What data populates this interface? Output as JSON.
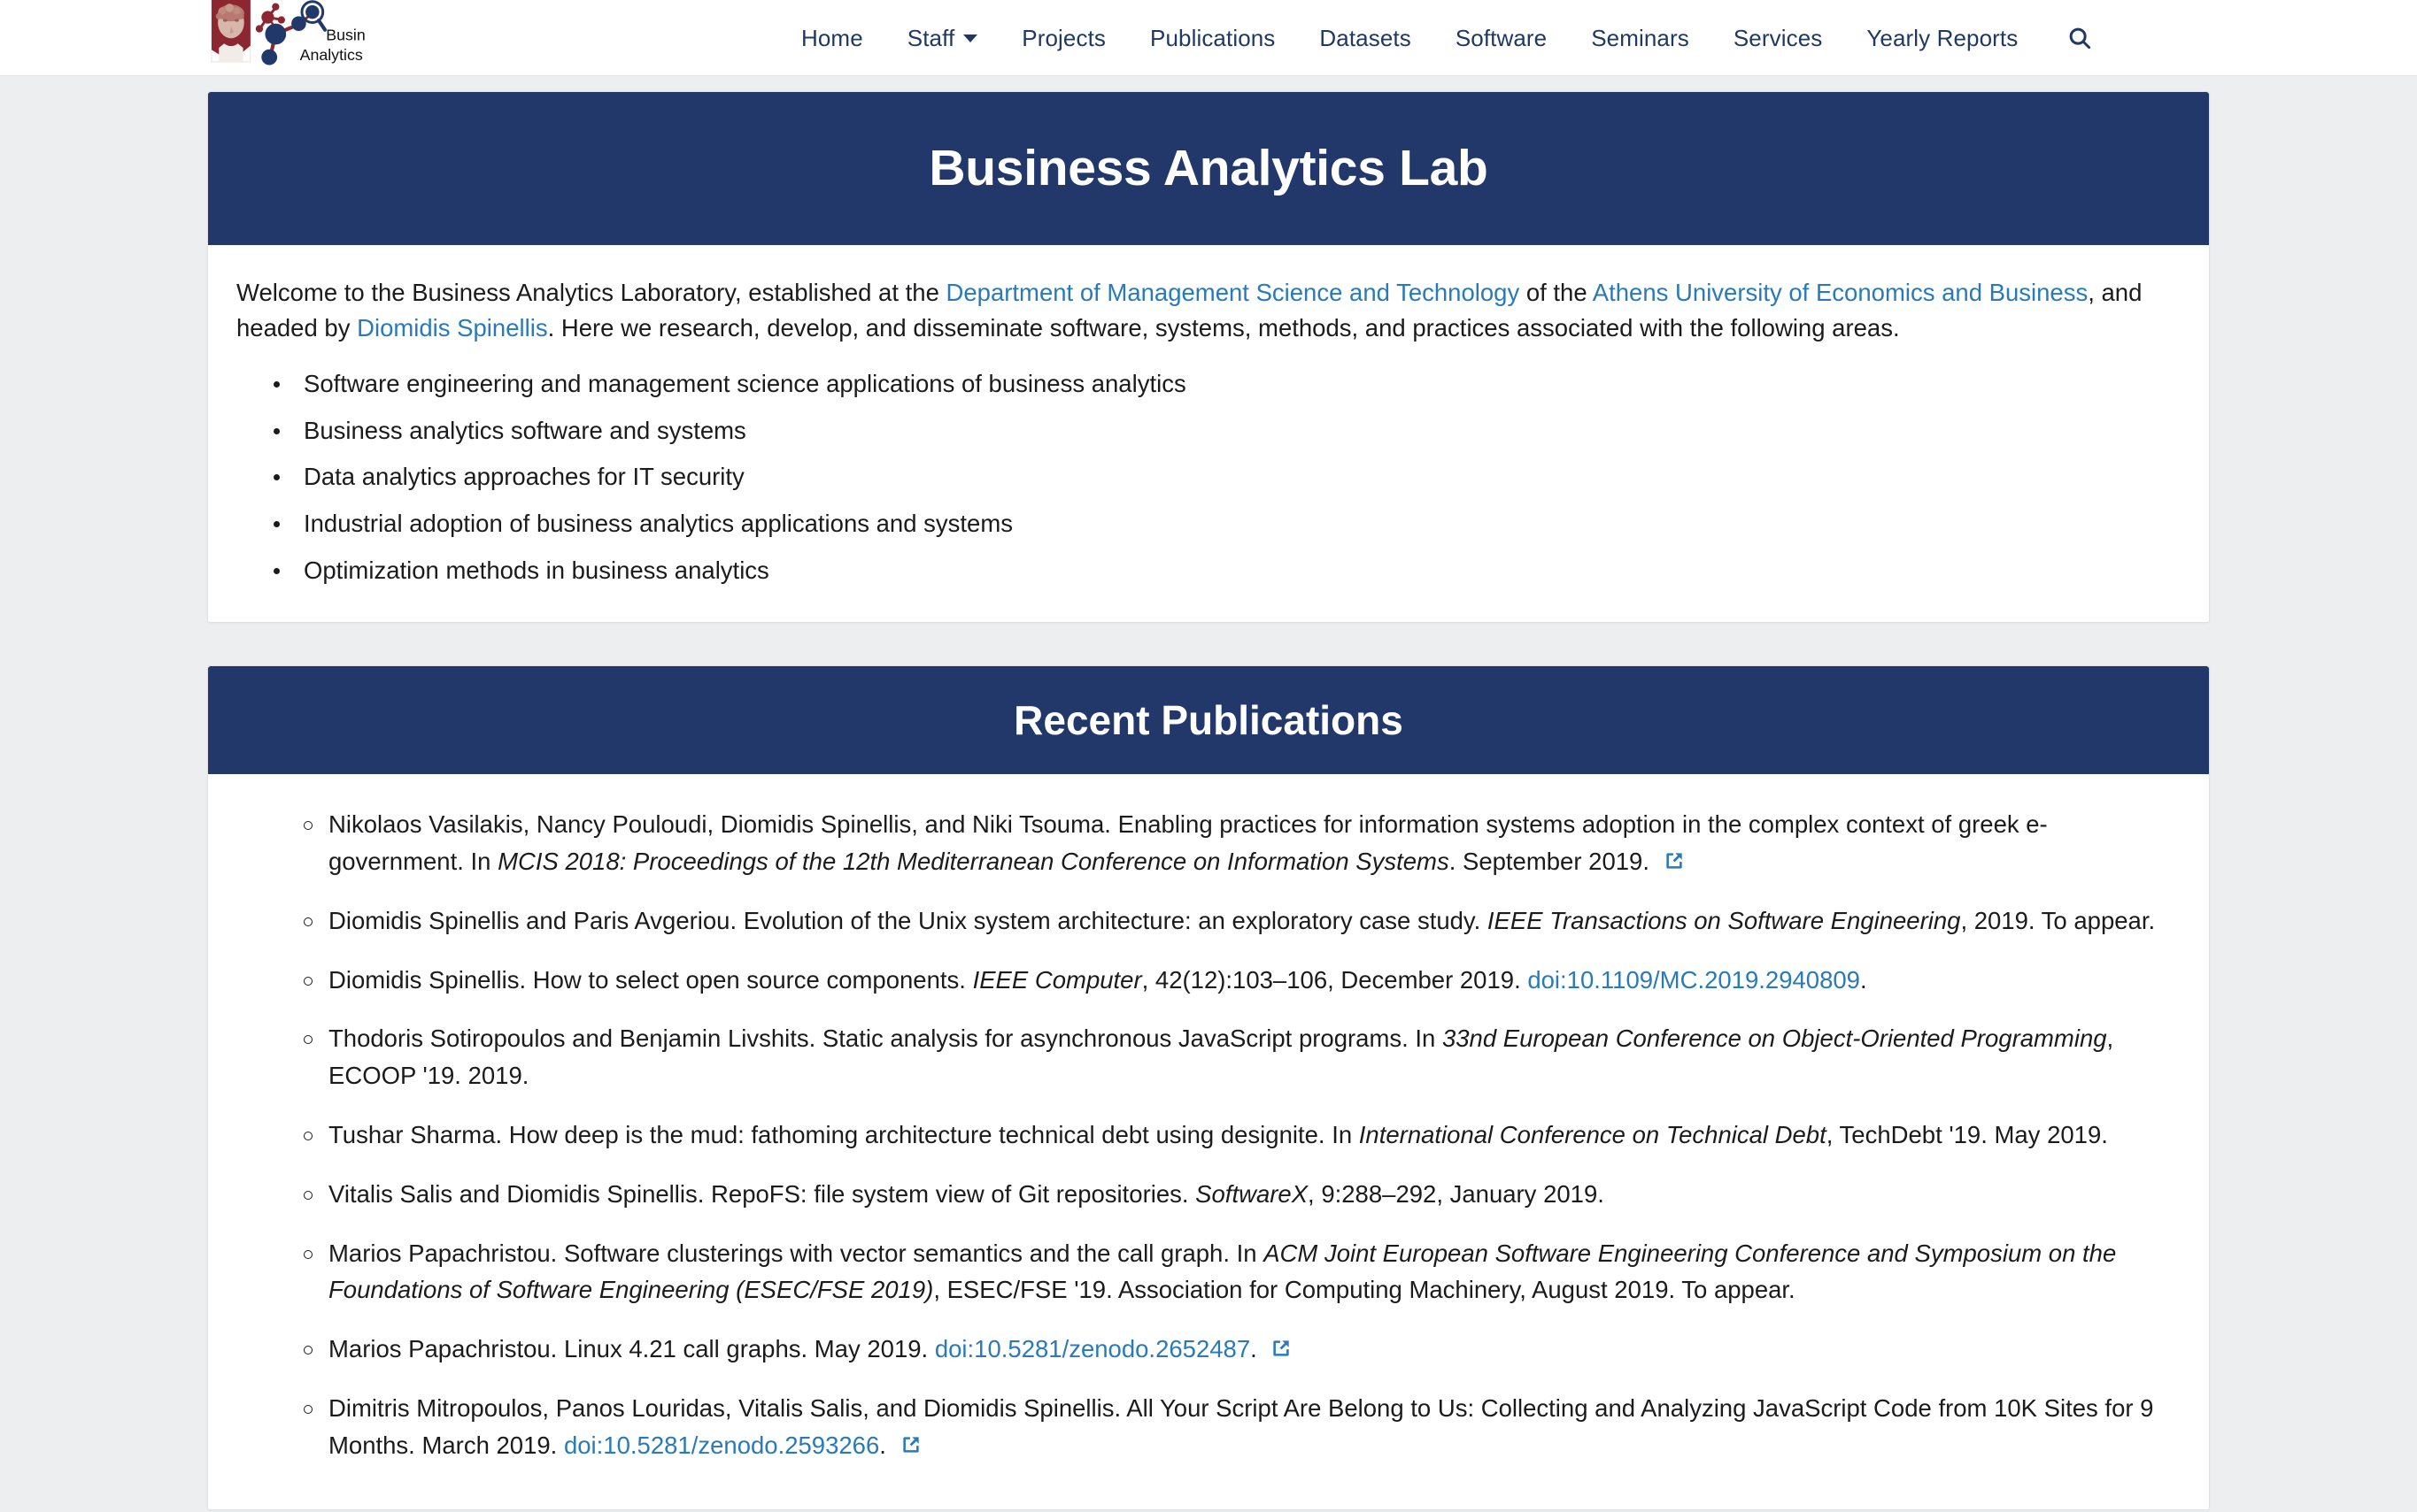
{
  "brand": {
    "name": "Business Analytics Lab",
    "logo_alt": "Business Analytics Lab logo",
    "line1": "Business",
    "line2": "Analytics Lab"
  },
  "nav": {
    "items": [
      {
        "label": "Home",
        "has_caret": false
      },
      {
        "label": "Staff",
        "has_caret": true
      },
      {
        "label": "Projects",
        "has_caret": false
      },
      {
        "label": "Publications",
        "has_caret": false
      },
      {
        "label": "Datasets",
        "has_caret": false
      },
      {
        "label": "Software",
        "has_caret": false
      },
      {
        "label": "Seminars",
        "has_caret": false
      },
      {
        "label": "Services",
        "has_caret": false
      },
      {
        "label": "Yearly Reports",
        "has_caret": false
      }
    ],
    "search_icon": "search-icon"
  },
  "hero": {
    "title": "Business Analytics Lab"
  },
  "intro": {
    "part1": "Welcome to the Business Analytics Laboratory, established at the ",
    "link1": "Department of Management Science and Technology",
    "part2": " of the ",
    "link2": "Athens University of Economics and Business",
    "part3": ", and headed by ",
    "link3": "Diomidis Spinellis",
    "part4": ". Here we research, develop, and disseminate software, systems, methods, and practices associated with the following areas."
  },
  "areas": [
    "Software engineering and management science applications of business analytics",
    "Business analytics software and systems",
    "Data analytics approaches for IT security",
    "Industrial adoption of business analytics applications and systems",
    "Optimization methods in business analytics"
  ],
  "publications_section": {
    "title": "Recent Publications"
  },
  "publications": [
    {
      "id": "pub-1",
      "segments": [
        {
          "type": "text",
          "value": "Nikolaos Vasilakis, Nancy Pouloudi, Diomidis Spinellis, and Niki Tsouma. Enabling practices for information systems adoption in the complex context of greek e-government. In "
        },
        {
          "type": "italic",
          "value": "MCIS 2018: Proceedings of the 12th Mediterranean Conference on Information Systems"
        },
        {
          "type": "text",
          "value": ". September 2019. "
        },
        {
          "type": "ext-link-icon",
          "value": "external-link-icon"
        }
      ]
    },
    {
      "id": "pub-2",
      "segments": [
        {
          "type": "text",
          "value": "Diomidis Spinellis and Paris Avgeriou. Evolution of the Unix system architecture: an exploratory case study. "
        },
        {
          "type": "italic",
          "value": "IEEE Transactions on Software Engineering"
        },
        {
          "type": "text",
          "value": ", 2019. To appear."
        }
      ]
    },
    {
      "id": "pub-3",
      "segments": [
        {
          "type": "text",
          "value": "Diomidis Spinellis. How to select open source components. "
        },
        {
          "type": "italic",
          "value": "IEEE Computer"
        },
        {
          "type": "text",
          "value": ", 42(12):103–106, December 2019. "
        },
        {
          "type": "link",
          "value": "doi:10.1109/MC.2019.2940809"
        },
        {
          "type": "text",
          "value": "."
        }
      ]
    },
    {
      "id": "pub-4",
      "segments": [
        {
          "type": "text",
          "value": "Thodoris Sotiropoulos and Benjamin Livshits. Static analysis for asynchronous JavaScript programs. In "
        },
        {
          "type": "italic",
          "value": "33nd European Conference on Object-Oriented Programming"
        },
        {
          "type": "text",
          "value": ", ECOOP '19. 2019."
        }
      ]
    },
    {
      "id": "pub-5",
      "segments": [
        {
          "type": "text",
          "value": "Tushar Sharma. How deep is the mud: fathoming architecture technical debt using designite. In "
        },
        {
          "type": "italic",
          "value": "International Conference on Technical Debt"
        },
        {
          "type": "text",
          "value": ", TechDebt '19. May 2019."
        }
      ]
    },
    {
      "id": "pub-6",
      "segments": [
        {
          "type": "text",
          "value": "Vitalis Salis and Diomidis Spinellis. RepoFS: file system view of Git repositories. "
        },
        {
          "type": "italic",
          "value": "SoftwareX"
        },
        {
          "type": "text",
          "value": ", 9:288–292, January 2019."
        }
      ]
    },
    {
      "id": "pub-7",
      "segments": [
        {
          "type": "text",
          "value": "Marios Papachristou. Software clusterings with vector semantics and the call graph. In "
        },
        {
          "type": "italic",
          "value": "ACM Joint European Software Engineering Conference and Symposium on the Foundations of Software Engineering (ESEC/FSE 2019)"
        },
        {
          "type": "text",
          "value": ", ESEC/FSE '19. Association for Computing Machinery, August 2019. To appear."
        }
      ]
    },
    {
      "id": "pub-8",
      "segments": [
        {
          "type": "text",
          "value": "Marios Papachristou. Linux 4.21 call graphs. May 2019. "
        },
        {
          "type": "link",
          "value": "doi:10.5281/zenodo.2652487"
        },
        {
          "type": "text",
          "value": ". "
        },
        {
          "type": "ext-link-icon",
          "value": "external-link-icon"
        }
      ]
    },
    {
      "id": "pub-9",
      "segments": [
        {
          "type": "text",
          "value": "Dimitris Mitropoulos, Panos Louridas, Vitalis Salis, and Diomidis Spinellis. All Your Script Are Belong to Us: Collecting and Analyzing JavaScript Code from 10K Sites for 9 Months. March 2019. "
        },
        {
          "type": "link",
          "value": "doi:10.5281/zenodo.2593266"
        },
        {
          "type": "text",
          "value": ". "
        },
        {
          "type": "ext-link-icon",
          "value": "external-link-icon"
        }
      ]
    }
  ],
  "colors": {
    "header_bg": "#22386a",
    "nav_text": "#1f3864",
    "link": "#2a7ab9",
    "page_bg": "#eceef0",
    "logo_dark_red": "#8c2630",
    "logo_navy": "#21386b"
  }
}
